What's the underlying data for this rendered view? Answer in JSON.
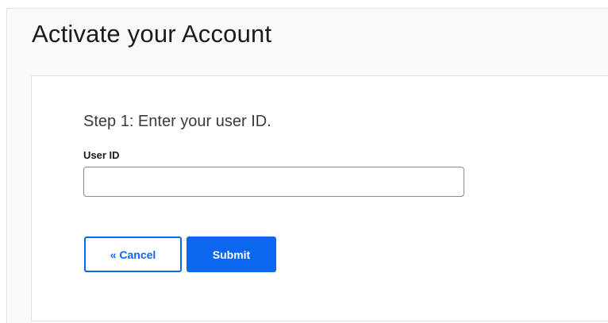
{
  "page": {
    "title": "Activate your Account"
  },
  "form": {
    "step_heading": "Step 1: Enter your user ID.",
    "user_id": {
      "label": "User ID",
      "value": "",
      "placeholder": ""
    },
    "buttons": {
      "cancel_label": "« Cancel",
      "submit_label": "Submit"
    }
  },
  "colors": {
    "accent": "#0b66f0",
    "background": "#f9f9f9",
    "card": "#ffffff"
  }
}
